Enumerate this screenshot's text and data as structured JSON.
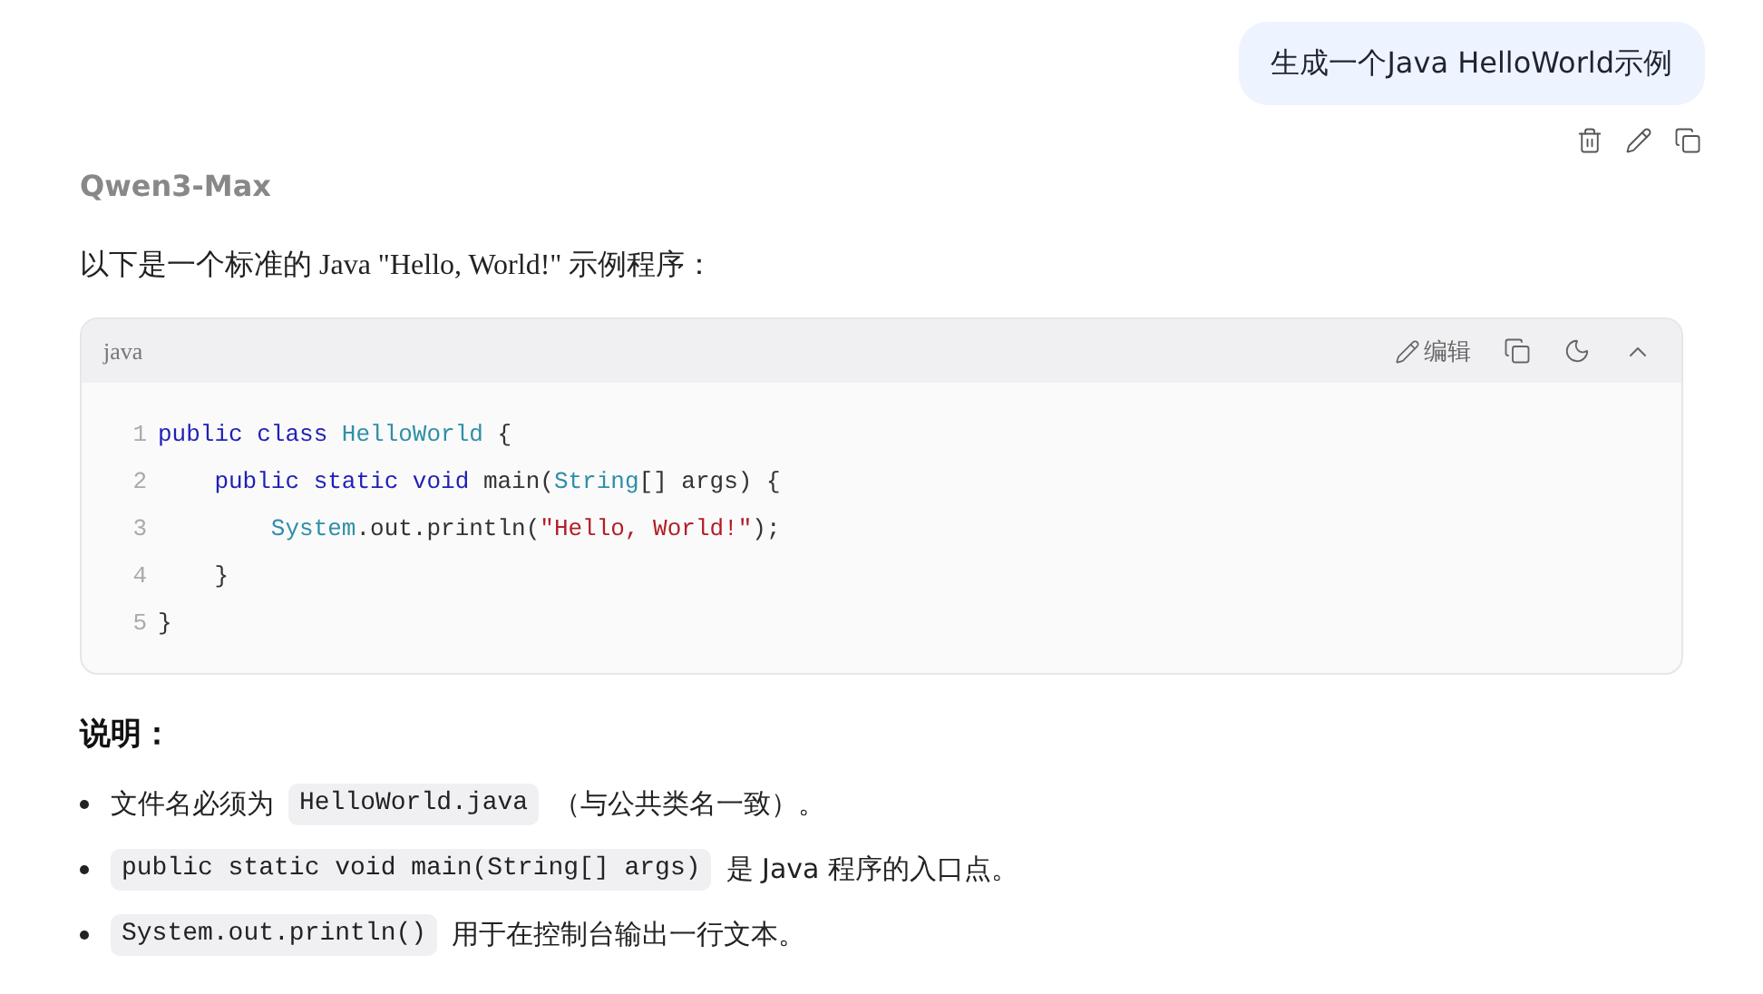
{
  "user_message": {
    "text": "生成一个Java HelloWorld示例"
  },
  "model_name": "Qwen3-Max",
  "intro": "以下是一个标准的 Java \"Hello, World!\" 示例程序：",
  "code_block": {
    "language": "java",
    "edit_label": "编辑",
    "lines": [
      {
        "number": "1",
        "tokens": [
          {
            "kind": "keyword",
            "text": "public class"
          },
          {
            "kind": "type",
            "text": " HelloWorld"
          },
          {
            "kind": "plain",
            "text": " {"
          }
        ]
      },
      {
        "number": "2",
        "tokens": [
          {
            "kind": "keyword",
            "text": "    public static void"
          },
          {
            "kind": "plain",
            "text": " main("
          },
          {
            "kind": "type",
            "text": "String"
          },
          {
            "kind": "plain",
            "text": "[] args) {"
          }
        ]
      },
      {
        "number": "3",
        "tokens": [
          {
            "kind": "type",
            "text": "        System"
          },
          {
            "kind": "plain",
            "text": ".out.println("
          },
          {
            "kind": "string",
            "text": "\"Hello, World!\""
          },
          {
            "kind": "plain",
            "text": ");"
          }
        ]
      },
      {
        "number": "4",
        "tokens": [
          {
            "kind": "plain",
            "text": "    }"
          }
        ]
      },
      {
        "number": "5",
        "tokens": [
          {
            "kind": "plain",
            "text": "}"
          }
        ]
      }
    ]
  },
  "heading": "说明：",
  "bullets": [
    {
      "segments": [
        {
          "kind": "text",
          "text": "文件名必须为"
        },
        {
          "kind": "code",
          "text": "HelloWorld.java"
        },
        {
          "kind": "text",
          "text": "（与公共类名一致）。"
        }
      ]
    },
    {
      "segments": [
        {
          "kind": "code",
          "text": "public static void main(String[] args)"
        },
        {
          "kind": "text",
          "text": "是 Java 程序的入口点。"
        }
      ]
    },
    {
      "segments": [
        {
          "kind": "code",
          "text": "System.out.println()"
        },
        {
          "kind": "text",
          "text": "用于在控制台输出一行文本。"
        }
      ]
    }
  ]
}
